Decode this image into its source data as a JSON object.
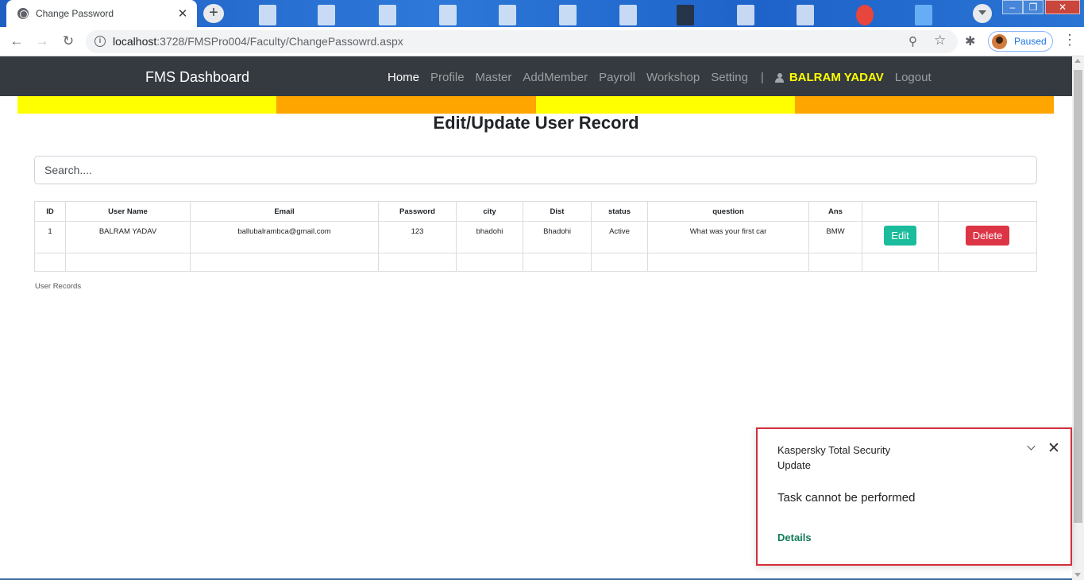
{
  "browser": {
    "tab_title": "Change Password",
    "tab_close": "✕",
    "new_tab": "+",
    "url_host": "localhost",
    "url_path": ":3728/FMSPro004/Faculty/ChangePassowrd.aspx",
    "profile_status": "Paused",
    "window_controls": [
      "–",
      "❐",
      "✕"
    ]
  },
  "navbar": {
    "brand": "FMS Dashboard",
    "links": [
      "Home",
      "Profile",
      "Master",
      "AddMember",
      "Payroll",
      "Workshop",
      "Setting"
    ],
    "active_link": "Home",
    "separator": "|",
    "user_name": "BALRAM YADAV",
    "logout": "Logout"
  },
  "stripe_colors": [
    "#ffff00",
    "#ffa500",
    "#ffff00",
    "#ffa500"
  ],
  "page": {
    "heading": "Edit/Update User Record",
    "search_placeholder": "Search....",
    "records_label": "User Records"
  },
  "table": {
    "headers": [
      "ID",
      "User Name",
      "Email",
      "Password",
      "city",
      "Dist",
      "status",
      "question",
      "Ans",
      "",
      ""
    ],
    "rows": [
      {
        "id": "1",
        "user_name": "BALRAM YADAV",
        "email": "ballubalrambca@gmail.com",
        "password": "123",
        "city": "bhadohi",
        "dist": "Bhadohi",
        "status": "Active",
        "question": "What was your first car",
        "ans": "BMW",
        "edit_label": "Edit",
        "delete_label": "Delete"
      }
    ]
  },
  "toast": {
    "app": "Kaspersky Total Security",
    "subtitle": "Update",
    "message": "Task cannot be performed",
    "link": "Details",
    "close": "✕"
  },
  "colors": {
    "navbar_bg": "#343a40",
    "user_highlight": "#ffff00",
    "edit_button": "#1abc9c",
    "delete_button": "#dc3545",
    "toast_border": "#d32f3d",
    "toast_link": "#107c56"
  }
}
